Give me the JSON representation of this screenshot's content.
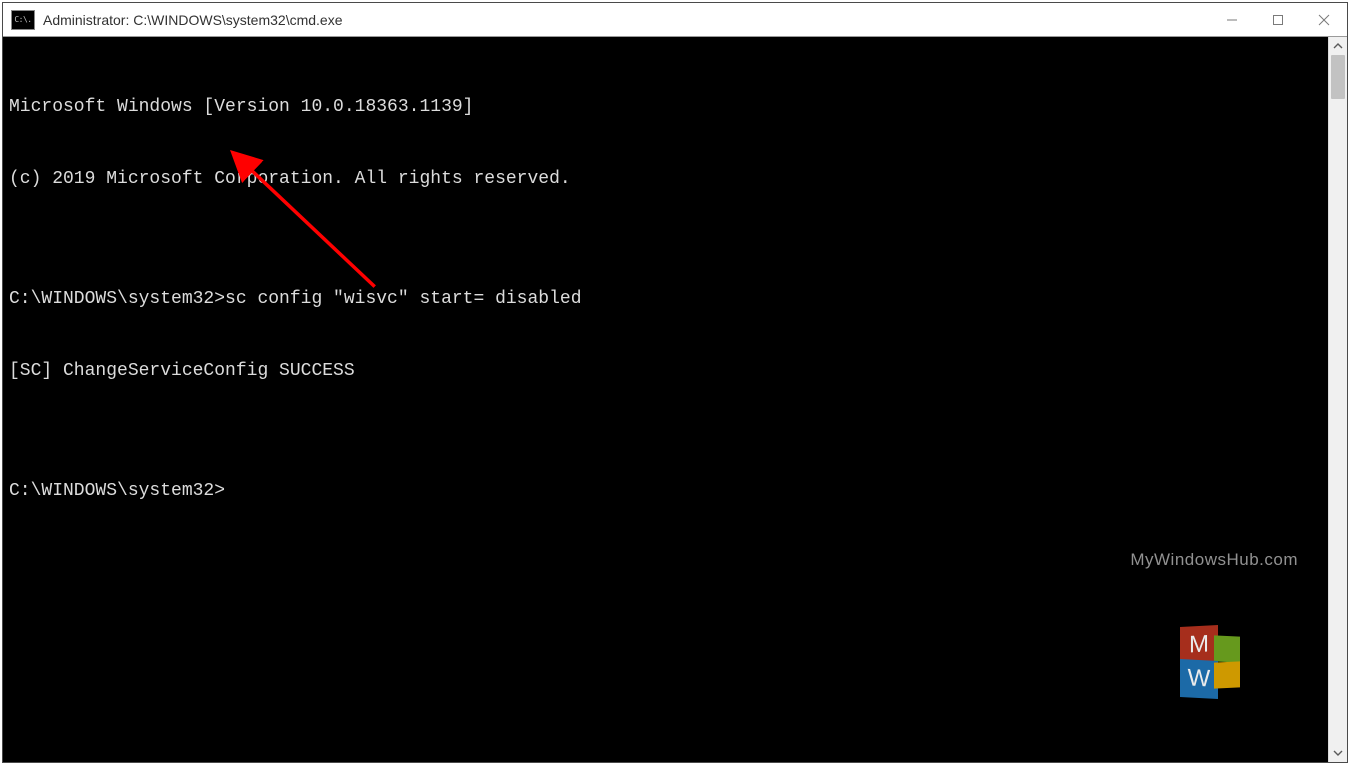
{
  "titlebar": {
    "title": "Administrator: C:\\WINDOWS\\system32\\cmd.exe",
    "icon_glyph": "C:\\."
  },
  "terminal": {
    "lines": [
      "Microsoft Windows [Version 10.0.18363.1139]",
      "(c) 2019 Microsoft Corporation. All rights reserved.",
      "",
      "C:\\WINDOWS\\system32>sc config \"wisvc\" start= disabled",
      "[SC] ChangeServiceConfig SUCCESS",
      "",
      "C:\\WINDOWS\\system32>"
    ]
  },
  "watermark": {
    "text": "MyWindowsHub.com",
    "m": "M",
    "w": "W"
  },
  "annotation": {
    "arrow_color": "#ff0000"
  }
}
